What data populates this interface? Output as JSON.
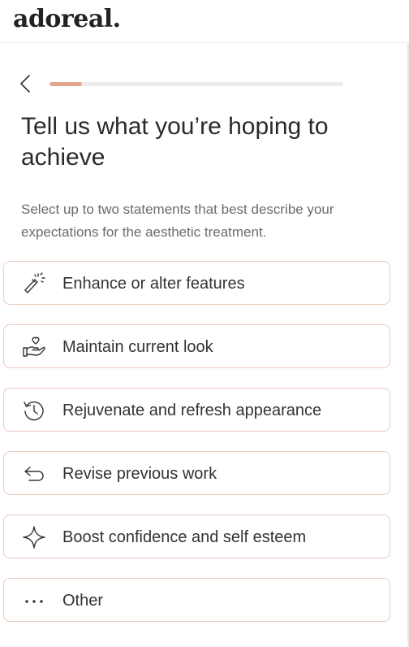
{
  "header": {
    "logo": "adoreal."
  },
  "progress": {
    "value": 0.11
  },
  "page": {
    "title": "Tell us what you’re hoping to achieve",
    "subtitle": "Select up to two statements that best describe your expectations for the aesthetic treatment."
  },
  "options": [
    {
      "label": "Enhance or alter features",
      "icon": "magic-wand-icon"
    },
    {
      "label": "Maintain current look",
      "icon": "heart-hand-icon"
    },
    {
      "label": "Rejuvenate and refresh appearance",
      "icon": "clock-refresh-icon"
    },
    {
      "label": "Revise previous work",
      "icon": "undo-arrow-icon"
    },
    {
      "label": "Boost confidence and self esteem",
      "icon": "sparkle-icon"
    },
    {
      "label": "Other",
      "icon": "more-dots-icon"
    }
  ],
  "colors": {
    "accent": "#e3a690",
    "option_border": "#ecc9bf",
    "text": "#2a2a2a",
    "muted": "#6b6b6b"
  }
}
